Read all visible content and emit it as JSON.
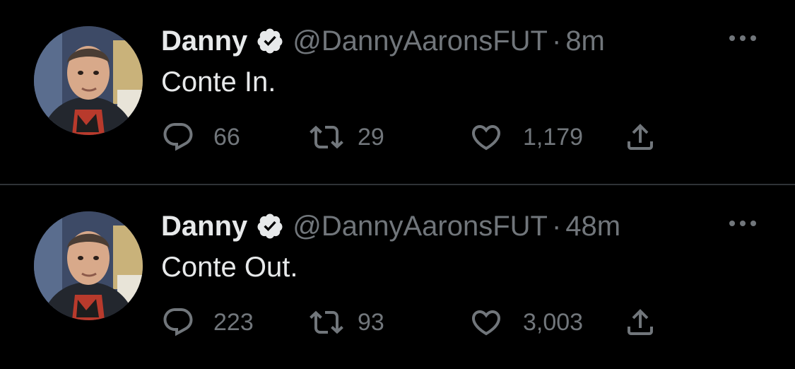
{
  "colors": {
    "background": "#000000",
    "text_primary": "#e7e9ea",
    "text_secondary": "#71767b",
    "divider": "#2f3336"
  },
  "icons": {
    "verified": "verified-badge-icon",
    "more": "more-options-icon",
    "reply": "reply-bubble-icon",
    "retweet": "retweet-icon",
    "like": "heart-icon",
    "share": "share-upload-icon"
  },
  "tweets": [
    {
      "author_name": "Danny",
      "author_handle": "@DannyAaronsFUT",
      "separator": "·",
      "time": "8m",
      "text": "Conte In.",
      "replies": "66",
      "retweets": "29",
      "likes": "1,179"
    },
    {
      "author_name": "Danny",
      "author_handle": "@DannyAaronsFUT",
      "separator": "·",
      "time": "48m",
      "text": "Conte Out.",
      "replies": "223",
      "retweets": "93",
      "likes": "3,003"
    }
  ]
}
